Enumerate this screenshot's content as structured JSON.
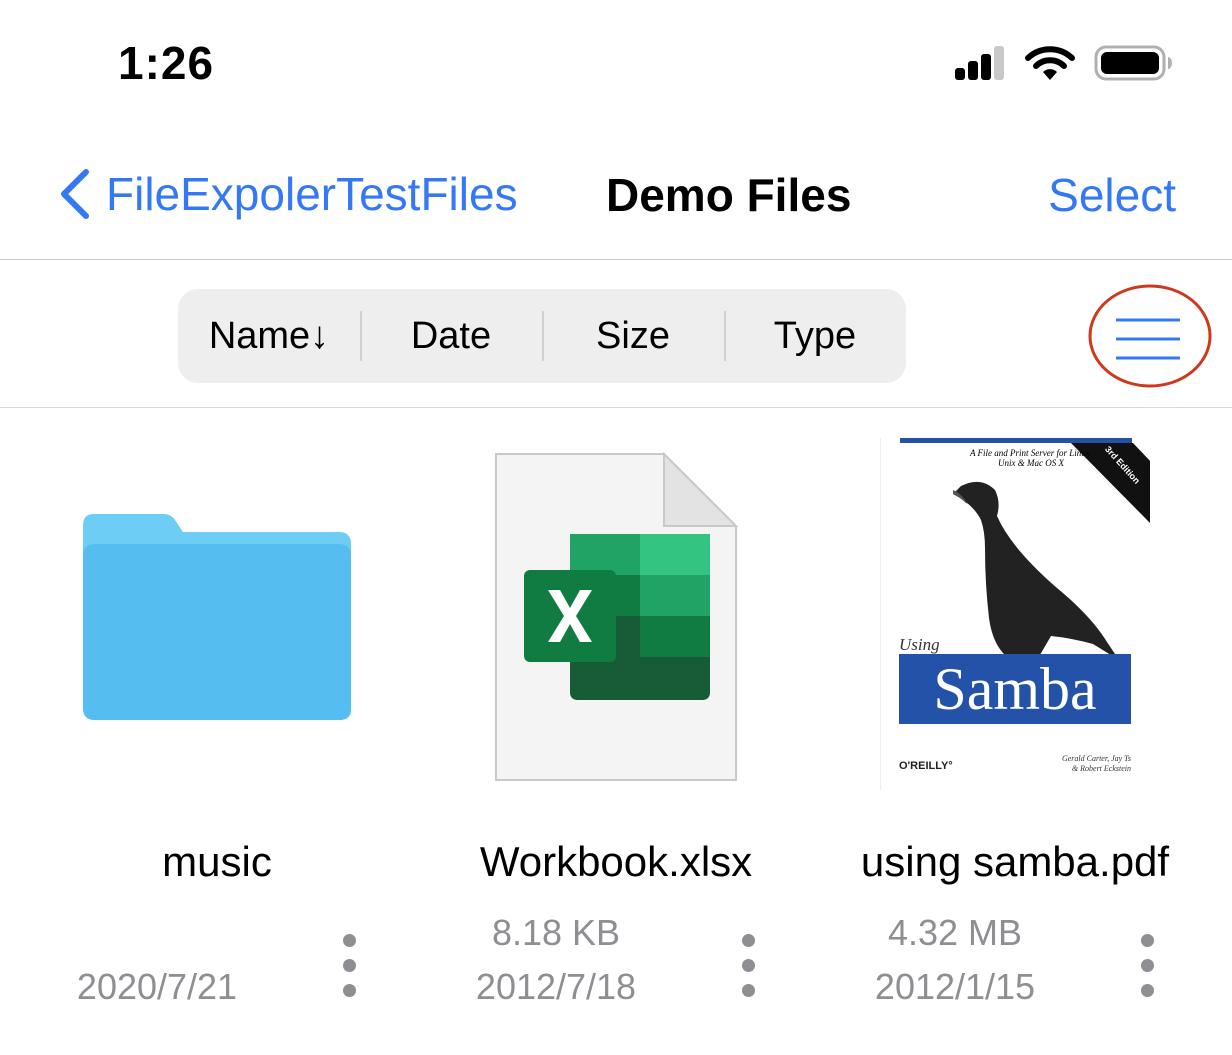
{
  "status_bar": {
    "time": "1:26",
    "icons": [
      "cellular-signal-icon",
      "wifi-icon",
      "battery-icon"
    ]
  },
  "nav": {
    "back_label": "FileExpolerTestFiles",
    "title": "Demo Files",
    "select_label": "Select"
  },
  "sort_bar": {
    "options": [
      "Name↓",
      "Date",
      "Size",
      "Type"
    ],
    "active": "Name"
  },
  "files": [
    {
      "name": "music",
      "size": "",
      "date": "2020/7/21",
      "kind": "folder-icon"
    },
    {
      "name": "Workbook.xlsx",
      "size": "8.18 KB",
      "date": "2012/7/18",
      "kind": "excel-file-icon"
    },
    {
      "name": "using samba.pdf",
      "size": "4.32 MB",
      "date": "2012/1/15",
      "kind": "pdf-thumbnail",
      "cover": {
        "top_line": "A File and Print Server for Linux,",
        "top_line2": "Unix & Mac OS X",
        "edition": "3rd Edition",
        "using": "Using",
        "title": "Samba",
        "publisher": "O'REILLY°",
        "authors": "Gerald Carter, Jay Ts",
        "authors2": "& Robert Eckstein"
      }
    }
  ],
  "colors": {
    "accent": "#3478f6",
    "highlight_circle": "#d0381e",
    "folder": "#56bdf1",
    "excel_dark": "#1d6f42",
    "samba_blue": "#2452a8"
  }
}
